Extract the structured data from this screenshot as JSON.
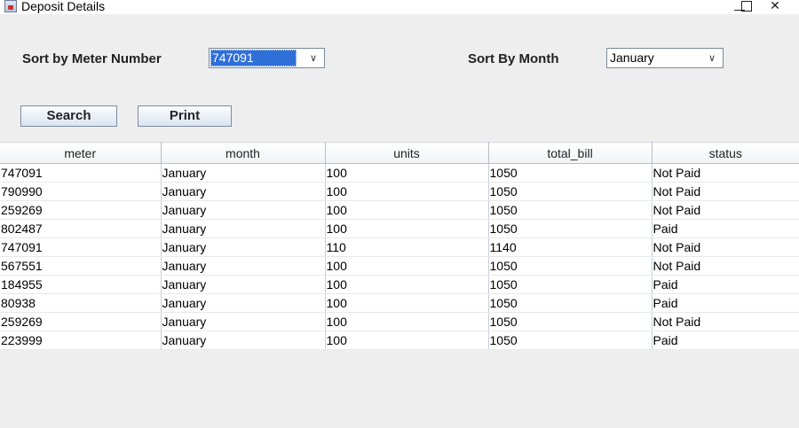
{
  "window": {
    "title": "Deposit Details",
    "controls": {
      "minimize_icon": "minimize-icon",
      "maximize_icon": "maximize-icon",
      "close_icon": "close-icon",
      "close_glyph": "✕"
    }
  },
  "filters": {
    "meter_label": "Sort by Meter Number",
    "meter_value": "747091",
    "month_label": "Sort By Month",
    "month_value": "January",
    "dropdown_glyph": "∨"
  },
  "buttons": {
    "search_label": "Search",
    "print_label": "Print"
  },
  "table": {
    "columns": [
      "meter",
      "month",
      "units",
      "total_bill",
      "status"
    ],
    "rows": [
      [
        "747091",
        "January",
        "100",
        "1050",
        "Not Paid"
      ],
      [
        "790990",
        "January",
        "100",
        "1050",
        "Not Paid"
      ],
      [
        "259269",
        "January",
        "100",
        "1050",
        "Not Paid"
      ],
      [
        "802487",
        "January",
        "100",
        "1050",
        "Paid"
      ],
      [
        "747091",
        "January",
        "110",
        "1140",
        "Not Paid"
      ],
      [
        "567551",
        "January",
        "100",
        "1050",
        "Not Paid"
      ],
      [
        "184955",
        "January",
        "100",
        "1050",
        "Paid"
      ],
      [
        "80938",
        "January",
        "100",
        "1050",
        "Paid"
      ],
      [
        "259269",
        "January",
        "100",
        "1050",
        "Not Paid"
      ],
      [
        "223999",
        "January",
        "100",
        "1050",
        "Paid"
      ]
    ]
  },
  "colors": {
    "selection": "#2f6fd8",
    "window_bg": "#eeeeee"
  }
}
